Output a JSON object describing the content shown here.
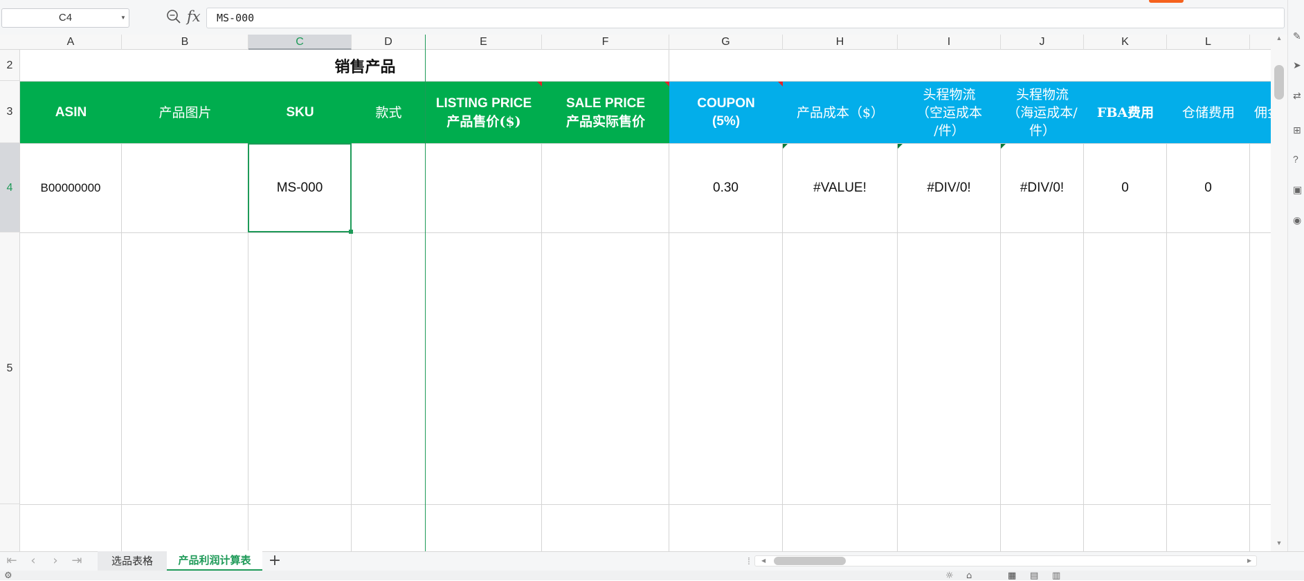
{
  "formula_bar": {
    "cell_ref": "C4",
    "fx_label": "fx",
    "formula": "MS-000"
  },
  "columns": [
    "A",
    "B",
    "C",
    "D",
    "E",
    "F",
    "G",
    "H",
    "I",
    "J",
    "K",
    "L"
  ],
  "rows": [
    "2",
    "3",
    "4",
    "5"
  ],
  "sheet": {
    "title": "销售产品",
    "headers": {
      "asin": "ASIN",
      "image": "产品图片",
      "sku": "SKU",
      "style": "款式",
      "listing_en": "LISTING PRICE",
      "listing_cn": "产品售价($)",
      "sale_en": "SALE PRICE",
      "sale_cn": "产品实际售价",
      "coupon_1": "COUPON",
      "coupon_2": "(5%)",
      "cost": "产品成本（$）",
      "air_1": "头程物流",
      "air_2": "（空运成本",
      "air_3": "/件）",
      "sea_1": "头程物流",
      "sea_2": "（海运成本/",
      "sea_3": "件）",
      "fba": "FBA费用",
      "storage": "仓储费用",
      "commission": "佣金"
    },
    "row4": {
      "asin": "B00000000",
      "sku": "MS-000",
      "coupon": "0.30",
      "cost": "#VALUE!",
      "air": "#DIV/0!",
      "sea": "#DIV/0!",
      "fba": "0",
      "storage": "0"
    }
  },
  "tabs": [
    {
      "label": "选品表格",
      "active": false
    },
    {
      "label": "产品利润计算表",
      "active": true
    }
  ],
  "colors": {
    "header_green": "#00ad4e",
    "header_blue": "#03aeea",
    "selection": "#1e9a58",
    "comment_marker": "#e0252a"
  },
  "icons": {
    "zoom": "zoom-icon",
    "add_sheet": "plus-icon",
    "nav_first": "first-sheet-icon",
    "nav_prev": "prev-sheet-icon",
    "nav_next": "next-sheet-icon",
    "nav_last": "last-sheet-icon"
  }
}
